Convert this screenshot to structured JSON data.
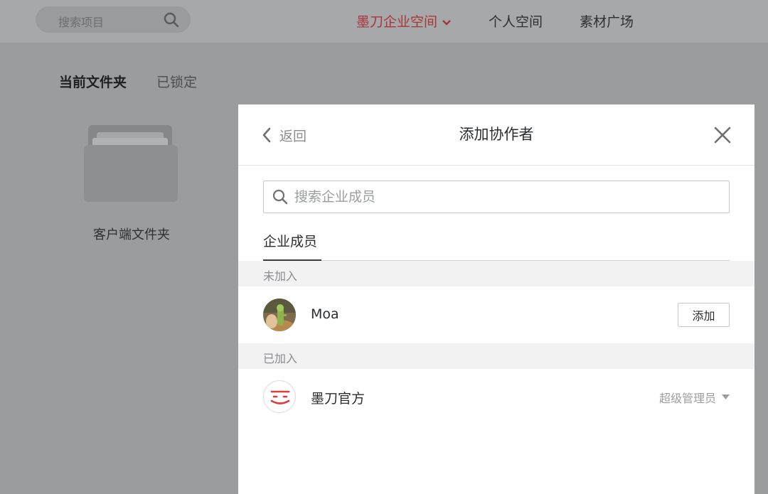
{
  "topbar": {
    "search_placeholder": "搜索项目",
    "nav": [
      {
        "label": "墨刀企业空间",
        "active": true
      },
      {
        "label": "个人空间",
        "active": false
      },
      {
        "label": "素材广场",
        "active": false
      }
    ]
  },
  "folder_view": {
    "tabs": [
      {
        "label": "当前文件夹",
        "active": true
      },
      {
        "label": "已锁定",
        "active": false
      }
    ],
    "folders": [
      {
        "name": "客户端文件夹",
        "icon": "folder-icon"
      }
    ]
  },
  "modal": {
    "back_label": "返回",
    "title": "添加协作者",
    "search_placeholder": "搜索企业成员",
    "tab_label": "企业成员",
    "sections": [
      {
        "label": "未加入",
        "members": [
          {
            "name": "Moa",
            "action": "添加"
          }
        ]
      },
      {
        "label": "已加入",
        "members": [
          {
            "name": "墨刀官方",
            "role": "超级管理员"
          }
        ]
      }
    ]
  },
  "colors": {
    "accent": "#e0393e",
    "overlay": "#9a9c9e",
    "modal_bg": "#ffffff",
    "section_bg": "#f2f2f3"
  }
}
